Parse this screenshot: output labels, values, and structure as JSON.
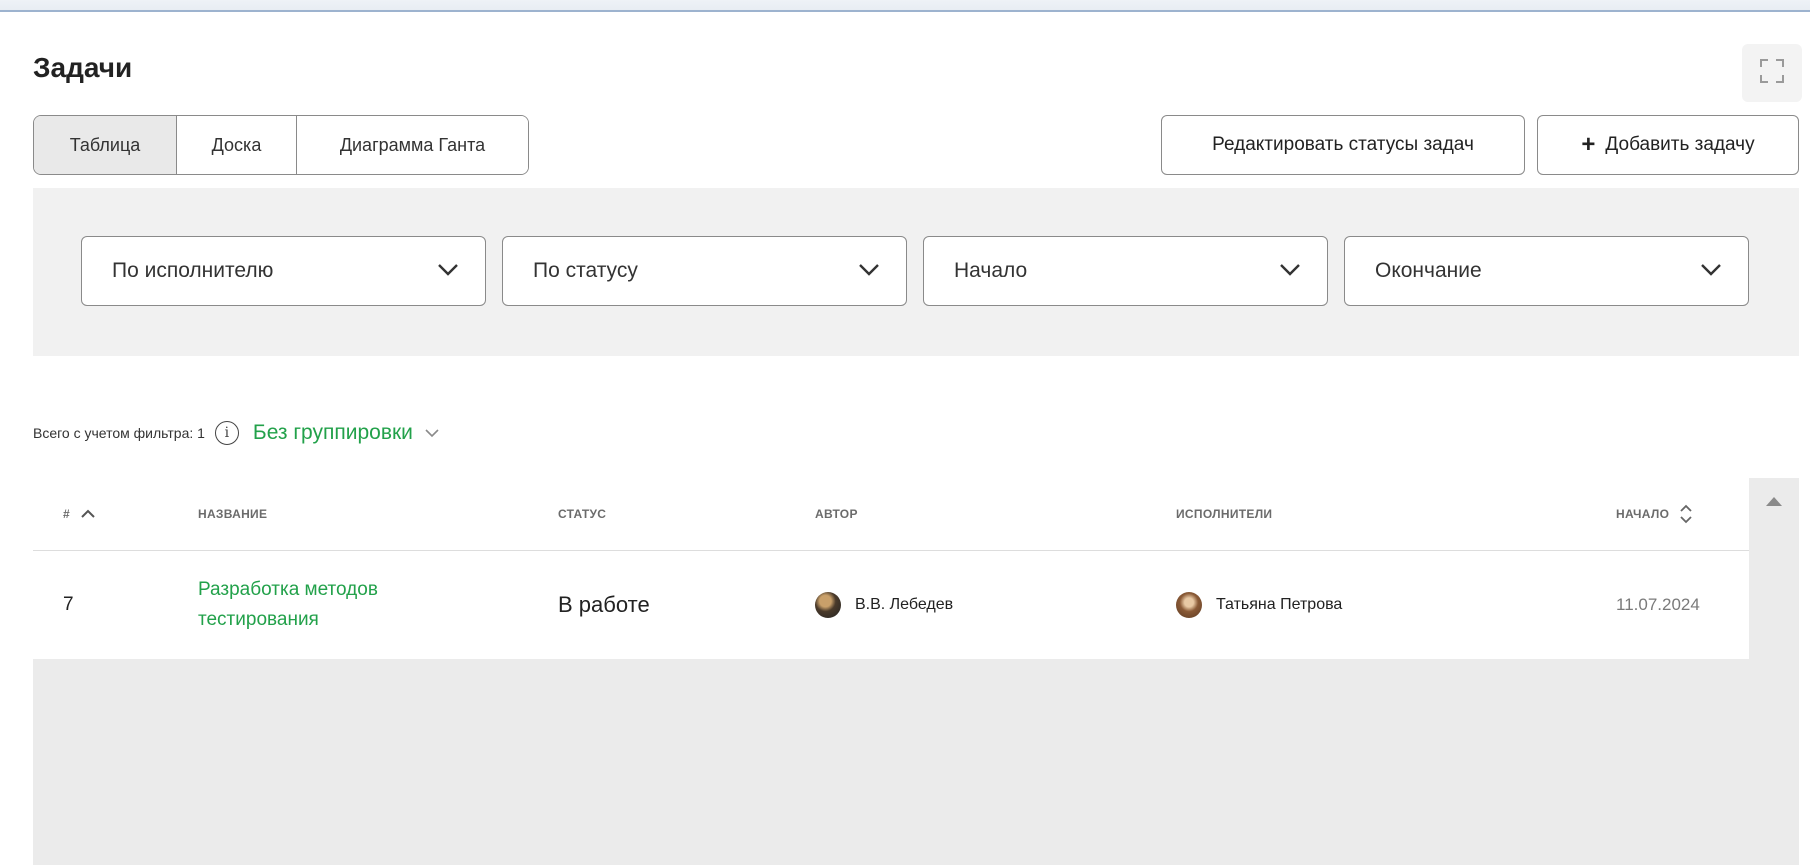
{
  "page": {
    "title": "Задачи"
  },
  "views": {
    "tabs": [
      {
        "label": "Таблица",
        "active": true
      },
      {
        "label": "Доска",
        "active": false
      },
      {
        "label": "Диаграмма Ганта",
        "active": false
      }
    ]
  },
  "actions": {
    "edit_statuses": "Редактировать статусы задач",
    "add_task_plus": "+",
    "add_task": "Добавить задачу"
  },
  "filters": [
    {
      "label": "По исполнителю"
    },
    {
      "label": "По статусу"
    },
    {
      "label": "Начало"
    },
    {
      "label": "Окончание"
    }
  ],
  "summary": {
    "count_text": "Всего с учетом фильтра: 1",
    "info_glyph": "i",
    "grouping": "Без группировки"
  },
  "table": {
    "columns": {
      "num": "#",
      "name": "НАЗВАНИЕ",
      "status": "СТАТУС",
      "author": "АВТОР",
      "assignees": "ИСПОЛНИТЕЛИ",
      "start": "НАЧАЛО"
    },
    "rows": [
      {
        "num": "7",
        "name": "Разработка методов тестирования",
        "status": "В работе",
        "author": "В.В. Лебедев",
        "assignee": "Татьяна Петрова",
        "start": "11.07.2024"
      }
    ]
  },
  "colors": {
    "accent_green": "#22a14a",
    "panel_bg": "#f1f1f1",
    "empty_bg": "#ebebeb"
  },
  "icons": {
    "fullscreen": "fullscreen-icon",
    "select_chevron": "chevron-down-icon",
    "sort_asc": "chevron-up-icon",
    "sort_both": "sort-icon",
    "scroll_up": "triangle-up-icon"
  }
}
